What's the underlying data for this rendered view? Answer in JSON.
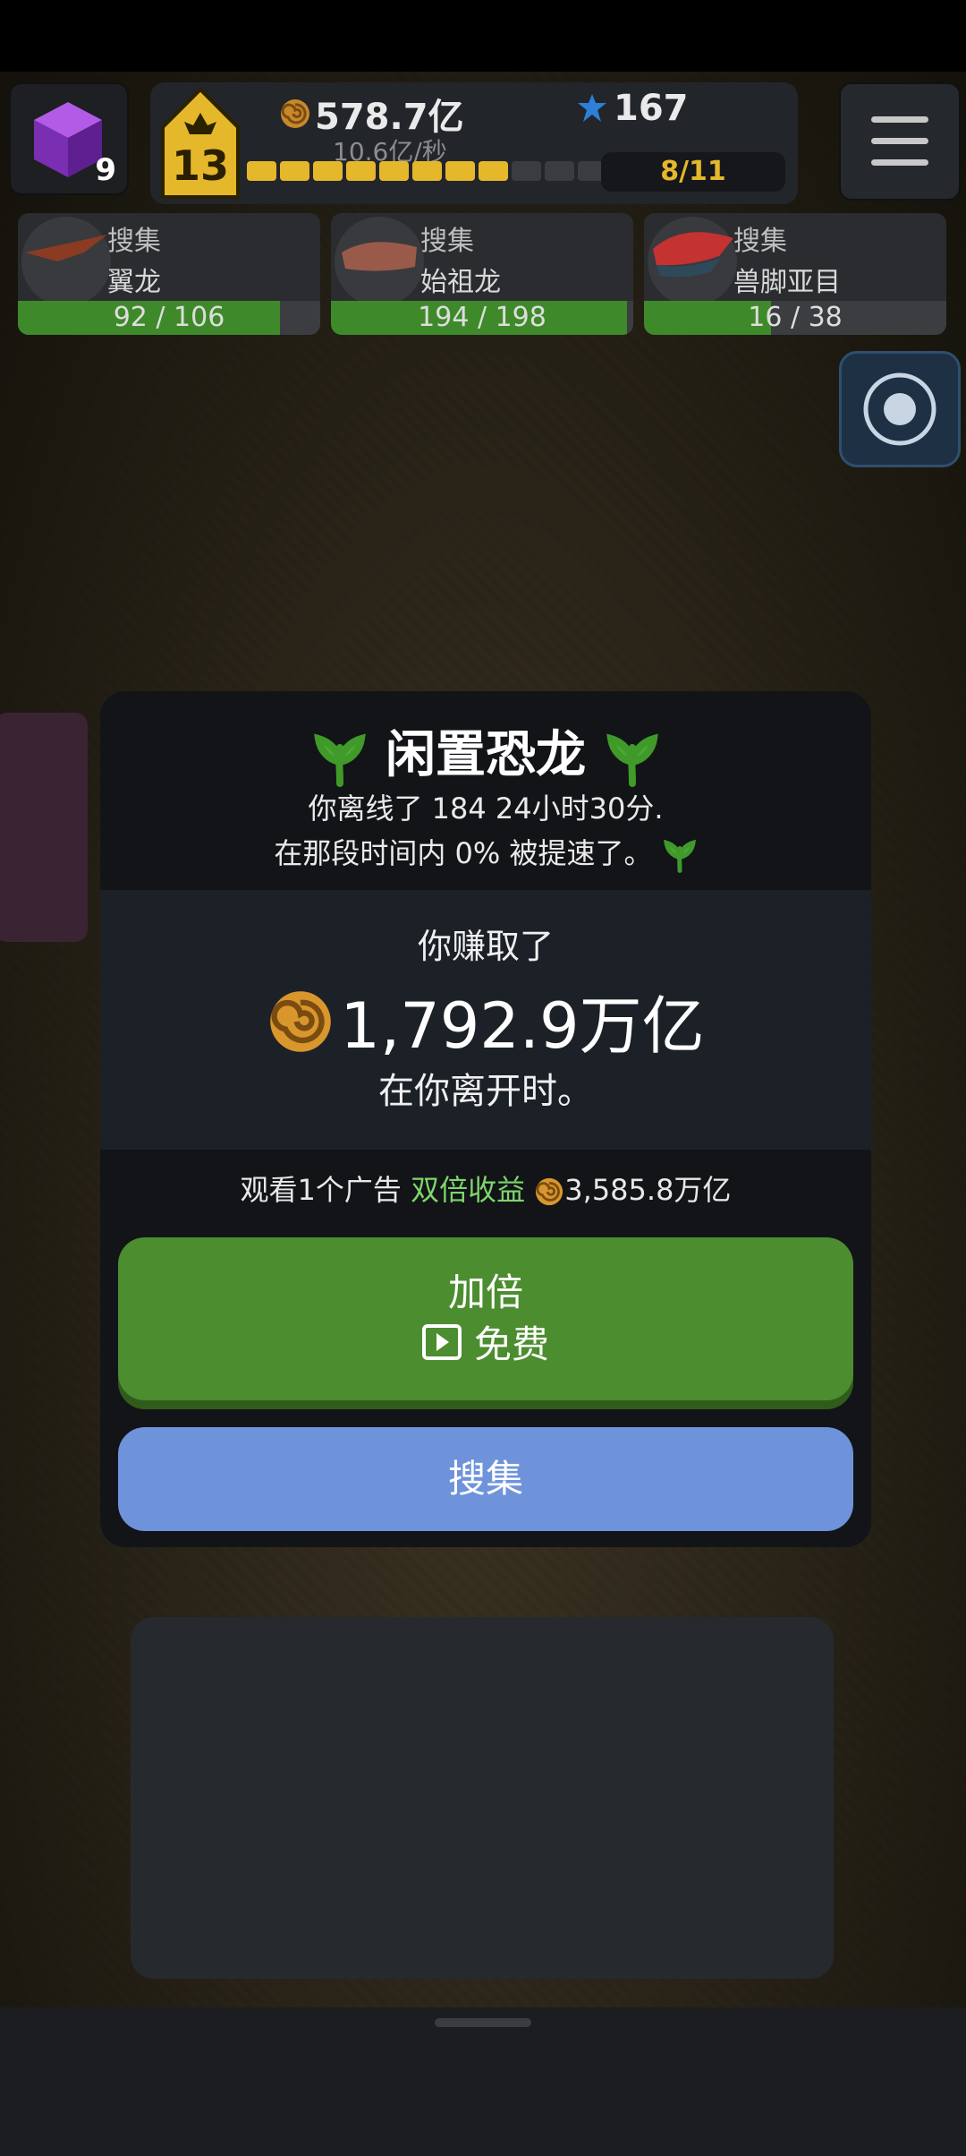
{
  "hud": {
    "cube_count": "9",
    "level": "13",
    "coins": "578.7亿",
    "rate": "10.6亿/秒",
    "gems": "167",
    "fill": "8/11",
    "progress_filled_segments": 8,
    "progress_total_segments": 11
  },
  "collect_cards": [
    {
      "action": "搜集",
      "name": "翼龙",
      "progress": "92 / 106",
      "ratio": 0.868
    },
    {
      "action": "搜集",
      "name": "始祖龙",
      "progress": "194 / 198",
      "ratio": 0.98
    },
    {
      "action": "搜集",
      "name": "兽脚亚目",
      "progress": "16 / 38",
      "ratio": 0.42
    }
  ],
  "modal": {
    "title": "闲置恐龙",
    "offline_text": "你离线了 184 24小时30分.",
    "boost_text": "在那段时间内 0% 被提速了。",
    "earned_label": "你赚取了",
    "earned_amount": "1,792.9万亿",
    "earned_suffix": "在你离开时。",
    "ad_prefix": "观看1个广告",
    "ad_highlight": "双倍收益",
    "ad_amount": "3,585.8万亿",
    "double_label": "加倍",
    "free_label": "免费",
    "collect_label": "搜集"
  },
  "colors": {
    "accent_green": "#4c8d2f",
    "collect_blue": "#6f93db",
    "highlight_green": "#7ed66a",
    "gold": "#e5b72a"
  },
  "icons": [
    "cube-icon",
    "level-badge-icon",
    "coin-icon",
    "gem-icon",
    "menu-icon",
    "radar-icon",
    "sprout-icon",
    "play-icon"
  ]
}
